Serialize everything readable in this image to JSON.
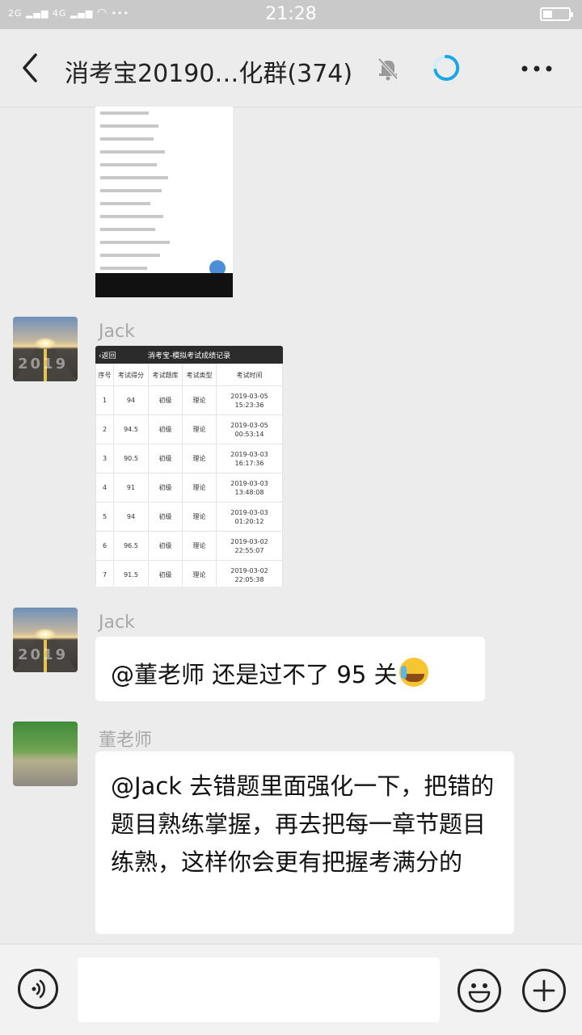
{
  "status_bar": {
    "signal_left": "2G",
    "signal_right": "4G",
    "more": "•••",
    "time": "21:28",
    "battery_level": 0.35
  },
  "header": {
    "title": "消考宝20190…化群(374)",
    "back_icon": "chevron-left-icon",
    "mute_icon": "bell-off-icon",
    "loading_icon": "spinner-icon",
    "more_icon": "more-dots-icon"
  },
  "messages": [
    {
      "type": "image",
      "description_icon": "screenshot-image"
    },
    {
      "type": "image",
      "sender": "Jack",
      "screenshot": {
        "back": "返回",
        "title": "消考宝-模拟考试成绩记录",
        "columns": [
          "序号",
          "考试得分",
          "考试题库",
          "考试类型",
          "考试时间"
        ],
        "rows": [
          [
            "1",
            "94",
            "初级",
            "理论",
            "2019-03-05",
            "15:23:36"
          ],
          [
            "2",
            "94.5",
            "初级",
            "理论",
            "2019-03-05",
            "00:53:14"
          ],
          [
            "3",
            "90.5",
            "初级",
            "理论",
            "2019-03-03",
            "16:17:36"
          ],
          [
            "4",
            "91",
            "初级",
            "理论",
            "2019-03-03",
            "13:48:08"
          ],
          [
            "5",
            "94",
            "初级",
            "理论",
            "2019-03-03",
            "01:20:12"
          ],
          [
            "6",
            "96.5",
            "初级",
            "理论",
            "2019-03-02",
            "22:55:07"
          ],
          [
            "7",
            "91.5",
            "初级",
            "理论",
            "2019-03-02",
            "22:05:38"
          ]
        ]
      }
    },
    {
      "type": "text",
      "sender": "Jack",
      "text": "@董老师  还是过不了 95 关",
      "emoji": "crying-laughing-emoji"
    },
    {
      "type": "text",
      "sender": "董老师",
      "text": "@Jack  去错题里面强化一下，把错的题目熟练掌握，再去把每一章节题目练熟，这样你会更有把握考满分的"
    }
  ],
  "input_bar": {
    "voice_icon": "voice-icon",
    "emoji_icon": "smiley-icon",
    "add_icon": "plus-circle-icon",
    "input_value": ""
  },
  "colors": {
    "status_bar": "#c9c9c9",
    "background": "#ececec",
    "bubble": "#ffffff",
    "accent_spinner": "#1aa7e8"
  }
}
